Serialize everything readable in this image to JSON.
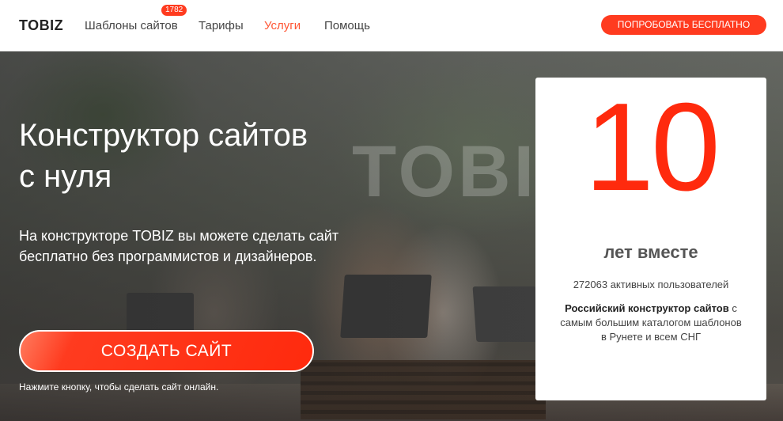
{
  "header": {
    "logo": "TOBIZ",
    "nav": {
      "templates": "Шаблоны сайтов",
      "templates_badge": "1782",
      "tariffs": "Тарифы",
      "services": "Услуги",
      "help": "Помощь"
    },
    "try_button": "ПОПРОБОВАТЬ БЕСПЛАТНО"
  },
  "hero": {
    "title_line1": "Конструктор сайтов",
    "title_line2": "с нуля",
    "subtitle_line1": "На конструкторе TOBIZ вы можете сделать сайт",
    "subtitle_line2": "бесплатно без программистов и дизайнеров.",
    "cta_button": "СОЗДАТЬ САЙТ",
    "cta_hint": "Нажмите кнопку, чтобы сделать сайт онлайн.",
    "background_word": "TOBIZ"
  },
  "card": {
    "big_number": "10",
    "years_label": "лет вместе",
    "users_text": "272063 активных пользователей",
    "desc_bold": "Российский конструктор сайтов",
    "desc_rest": " с самым большим каталогом шаблонов в Рунете и всем СНГ"
  },
  "colors": {
    "accent": "#ff3b1f",
    "services_active": "#ff5533",
    "big_number": "#ff2a0d"
  }
}
